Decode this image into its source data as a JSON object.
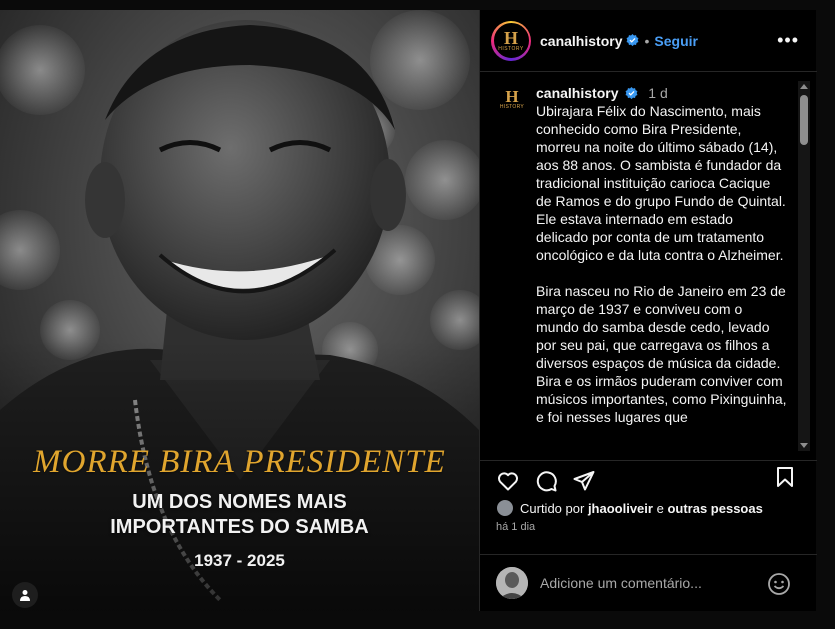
{
  "post_image": {
    "title": "MORRE BIRA PRESIDENTE",
    "subtitle_line1": "UM DOS NOMES MAIS",
    "subtitle_line2": "IMPORTANTES DO SAMBA",
    "years": "1937 - 2025",
    "tag_icon": "person-icon"
  },
  "header": {
    "avatar_logo": "H",
    "avatar_logo_sub": "HISTORY",
    "username": "canalhistory",
    "verified_icon": "verified-badge-icon",
    "separator": "•",
    "follow_label": "Seguir",
    "more_label": "•••"
  },
  "caption": {
    "avatar_logo": "H",
    "avatar_logo_sub": "HISTORY",
    "username": "canalhistory",
    "time": "1 d",
    "paragraph1": "Ubirajara Félix do Nascimento, mais conhecido como Bira Presidente, morreu na noite do último sábado (14), aos 88 anos. O sambista é fundador da tradicional instituição carioca Cacique de Ramos e do grupo Fundo de Quintal. Ele estava internado em estado delicado por conta de um tratamento oncológico e da luta contra o Alzheimer.",
    "paragraph2": "Bira nasceu no Rio de Janeiro em 23 de março de 1937 e conviveu com o mundo do samba desde cedo, levado por seu pai, que carregava os filhos a diversos espaços de música da cidade. Bira e os irmãos puderam conviver com músicos importantes, como Pixinguinha, e foi nesses lugares que"
  },
  "actions": {
    "like_icon": "heart-icon",
    "comment_icon": "comment-icon",
    "share_icon": "share-icon",
    "save_icon": "bookmark-icon"
  },
  "likes": {
    "prefix": "Curtido por",
    "user": "jhaooliveir",
    "connector": "e",
    "others": "outras pessoas"
  },
  "posted_ago": "há 1 dia",
  "comment_box": {
    "placeholder": "Adicione um comentário...",
    "emoji_icon": "smiley-icon"
  },
  "colors": {
    "accent_blue": "#4a9ef5",
    "title_gold": "#e0a52e",
    "background": "#000000"
  }
}
